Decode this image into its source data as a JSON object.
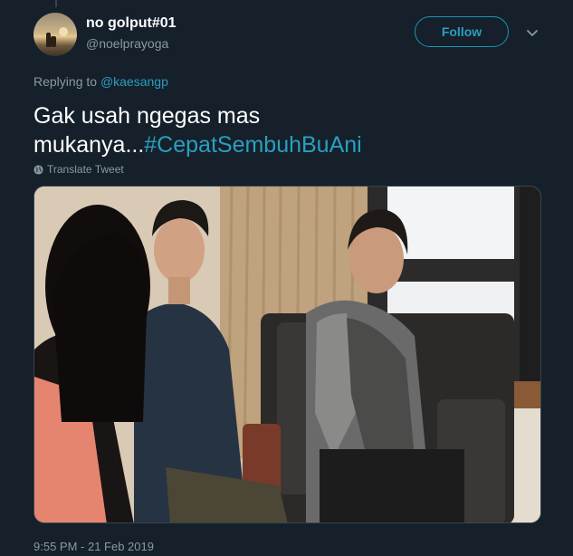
{
  "tweet": {
    "display_name": "no golput#01",
    "handle": "@noelprayoga",
    "follow_label": "Follow",
    "replying_prefix": "Replying to",
    "replying_to": "@kaesangp",
    "text_line1": "Gak usah ngegas mas",
    "text_line2": "mukanya...",
    "hashtag": "#CepatSembuhBuAni",
    "translate_label": "Translate Tweet",
    "timestamp": "9:55 PM - 21 Feb 2019"
  },
  "icons": {
    "more": "chevron-down-icon",
    "translate": "globe-icon"
  },
  "colors": {
    "background": "#15202b",
    "accent": "#2a9fbf",
    "secondary_text": "#8899a6"
  }
}
